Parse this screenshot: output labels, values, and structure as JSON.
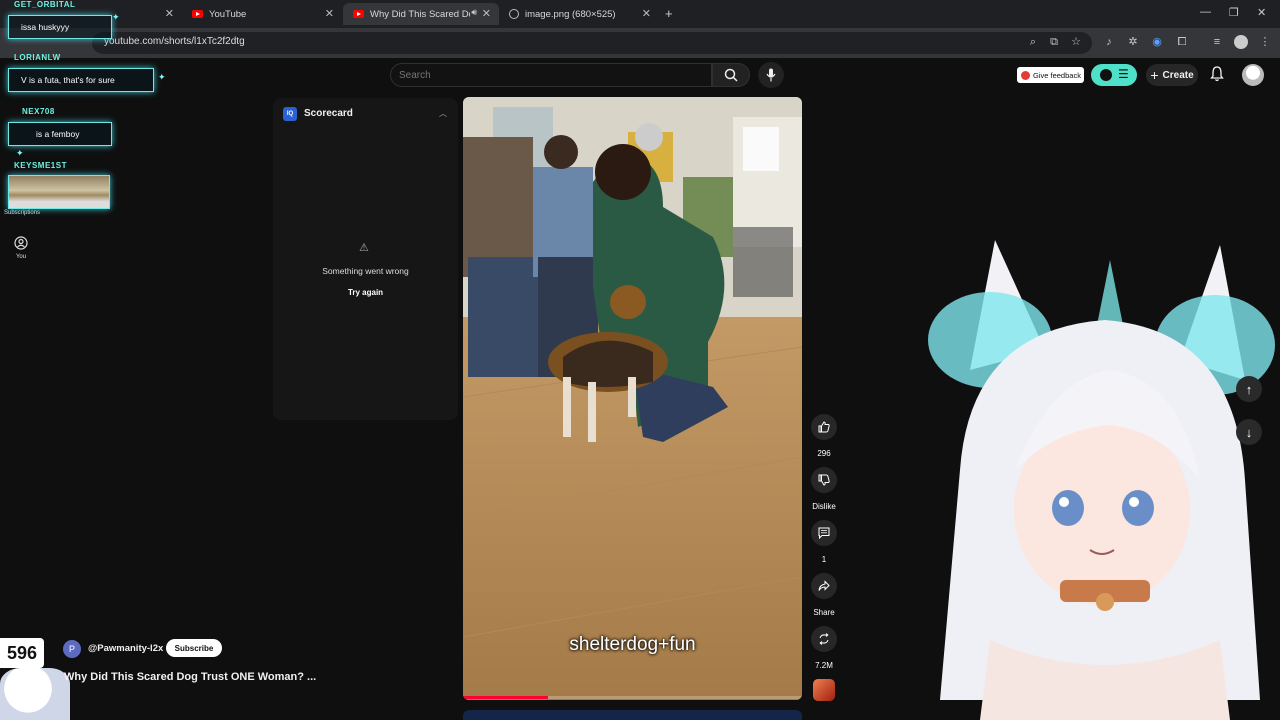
{
  "browser": {
    "tabs": [
      {
        "label": "",
        "favicon": "",
        "active": false
      },
      {
        "label": "YouTube",
        "favicon": "youtube-icon",
        "active": false
      },
      {
        "label": "Why Did This Scared Dog T",
        "favicon": "youtube-icon",
        "active": true
      },
      {
        "label": "image.png (680×525)",
        "favicon": "globe-icon",
        "active": false
      }
    ],
    "url": "youtube.com/shorts/l1xTc2f2dtg"
  },
  "header": {
    "search_placeholder": "Search",
    "feedback_label": "Give feedback",
    "create_label": "Create"
  },
  "nav": {
    "subscriptions_label": "Subscriptions",
    "you_label": "You"
  },
  "chat": [
    {
      "user": "GET_ORBITAL",
      "message": "issa huskyyy"
    },
    {
      "user": "LORIANLW",
      "message": "V is a futa, that's for sure"
    },
    {
      "user": "NEX708",
      "message": "is a femboy"
    },
    {
      "user": "KEYSME1ST",
      "message": ""
    }
  ],
  "scorecard": {
    "title": "Scorecard",
    "error": "Something went wrong",
    "retry": "Try again"
  },
  "video": {
    "subtitle": "shelterdog+fun",
    "progress": 0.25
  },
  "actions": {
    "likes": "296",
    "dislike_label": "Dislike",
    "comments": "1",
    "share_label": "Share",
    "remix_count": "7.2M"
  },
  "channel": {
    "initial": "P",
    "name": "@Pawmanity-l2x",
    "subscribe_label": "Subscribe",
    "video_title": "Why Did This Scared Dog Trust ONE Woman? ..."
  },
  "overlay": {
    "counter": "596"
  },
  "colors": {
    "accent_red": "#ff0033",
    "chat_glow": "#6fe8e6",
    "ext_teal": "#4fe0c9"
  }
}
